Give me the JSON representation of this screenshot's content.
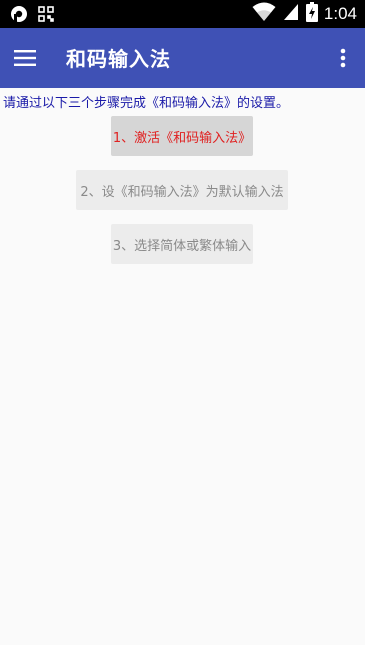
{
  "status_bar": {
    "time": "1:04",
    "icons": [
      "notification-icon",
      "qr-icon",
      "wifi-icon",
      "signal-icon",
      "battery-charging-icon"
    ]
  },
  "app_bar": {
    "title": "和码输入法",
    "menu_icon": "hamburger-menu-icon",
    "overflow_icon": "more-vert-icon",
    "color": "#3f51b5"
  },
  "main": {
    "instructions": "请通过以下三个步骤完成《和码输入法》的设置。",
    "steps": [
      {
        "label": "1、激活《和码输入法》",
        "active": true
      },
      {
        "label": "2、设《和码输入法》为默认输入法",
        "active": false
      },
      {
        "label": "3、选择简体或繁体输入",
        "active": false
      }
    ],
    "colors": {
      "instructions": "#1a1aa8",
      "active_step_text": "#e02020",
      "inactive_step_text": "#8a8a8a"
    }
  }
}
